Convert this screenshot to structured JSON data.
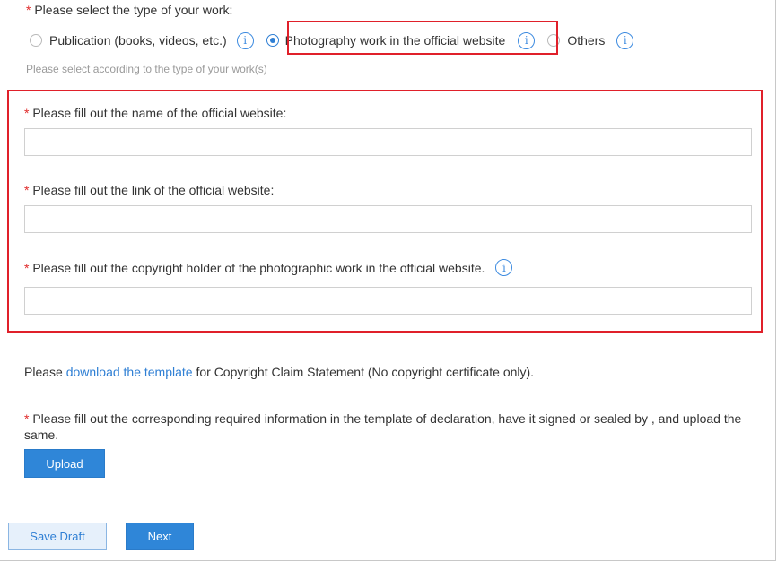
{
  "work_type": {
    "required_mark": "*",
    "title": "Please select the type of your work:",
    "options": [
      {
        "label": "Publication (books, videos, etc.)",
        "selected": false
      },
      {
        "label": "Photography work in the official website",
        "selected": true
      },
      {
        "label": "Others",
        "selected": false
      }
    ],
    "hint": "Please select according to the type of your work(s)"
  },
  "fields": {
    "website_name": {
      "required_mark": "*",
      "label": "Please fill out the name of the official website:",
      "value": "",
      "placeholder": ""
    },
    "website_link": {
      "required_mark": "*",
      "label": "Please fill out the link of the official website:",
      "value": "",
      "placeholder": ""
    },
    "copyright_holder": {
      "required_mark": "*",
      "label": "Please fill out the copyright holder of the photographic work in the official website.",
      "value": "",
      "placeholder": ""
    }
  },
  "template": {
    "prefix": "Please ",
    "link_text": "download the template",
    "suffix": " for Copyright Claim Statement (No copyright certificate only)."
  },
  "declaration": {
    "required_mark": "*",
    "text": "Please fill out the corresponding required information in the template of declaration, have it signed or sealed by , and upload the same."
  },
  "buttons": {
    "upload": "Upload",
    "save_draft": "Save Draft",
    "next": "Next"
  },
  "icons": {
    "info": "info-circle-icon",
    "info_glyph": "i"
  },
  "colors": {
    "accent": "#2f7fd4",
    "required": "#e02b2b",
    "highlight": "#e0202a"
  }
}
